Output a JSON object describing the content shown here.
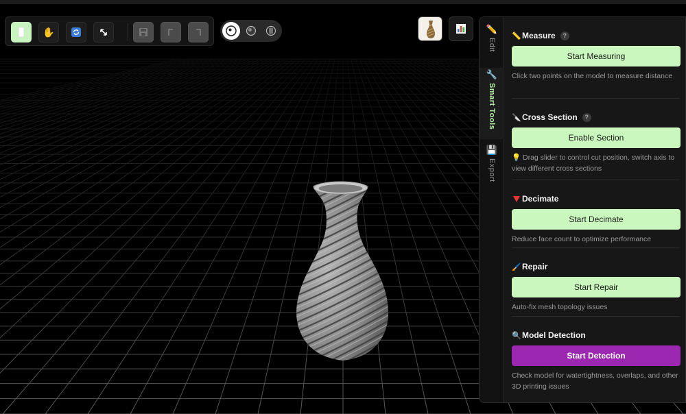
{
  "toolbar": {
    "tools": [
      {
        "name": "select-tool",
        "icon": "pointer-icon",
        "active": true
      },
      {
        "name": "pan-tool",
        "icon": "hand-icon"
      },
      {
        "name": "rotate-tool",
        "icon": "rotate-icon"
      },
      {
        "name": "scale-tool",
        "icon": "resize-icon"
      }
    ],
    "actions": [
      {
        "name": "save-button",
        "icon": "save-icon",
        "disabled": true
      },
      {
        "name": "undo-button",
        "icon": "undo-icon",
        "disabled": true
      },
      {
        "name": "redo-button",
        "icon": "redo-icon",
        "disabled": true
      }
    ]
  },
  "view_modes": [
    {
      "name": "view-solid",
      "icon": "solid-icon",
      "active": true
    },
    {
      "name": "view-shaded",
      "icon": "shaded-icon"
    },
    {
      "name": "view-wireframe",
      "icon": "wireframe-icon"
    }
  ],
  "tabs": [
    {
      "label": "Edit",
      "icon": "pencil-icon",
      "active": false
    },
    {
      "label": "Smart Tools",
      "icon": "wrench-icon",
      "active": true
    },
    {
      "label": "Export",
      "icon": "floppy-icon",
      "active": false
    }
  ],
  "sections": [
    {
      "title": "Measure",
      "icon": "ruler-icon",
      "has_help": true,
      "help_label": "?",
      "button": "Start Measuring",
      "description": "Click two points on the model to measure distance"
    },
    {
      "title": "Cross Section",
      "icon": "knife-icon",
      "has_help": true,
      "help_label": "?",
      "button": "Enable Section",
      "description": "💡 Drag slider to control cut position, switch axis to view different cross sections"
    },
    {
      "title": "Decimate",
      "icon": "triangle-down-icon",
      "has_help": false,
      "button": "Start Decimate",
      "description": "Reduce face count to optimize performance"
    },
    {
      "title": "Repair",
      "icon": "brush-icon",
      "has_help": false,
      "button": "Start Repair",
      "description": "Auto-fix mesh topology issues"
    },
    {
      "title": "Model Detection",
      "icon": "magnifier-icon",
      "has_help": false,
      "button": "Start Detection",
      "button_style": "purple",
      "description": "Check model for watertightness, overlaps, and other 3D printing issues"
    }
  ],
  "colors": {
    "accent_green": "#c9f7bd",
    "accent_purple": "#9c27b0",
    "active_tab_text": "#b9f2a8",
    "model": "#8f8f8f"
  }
}
